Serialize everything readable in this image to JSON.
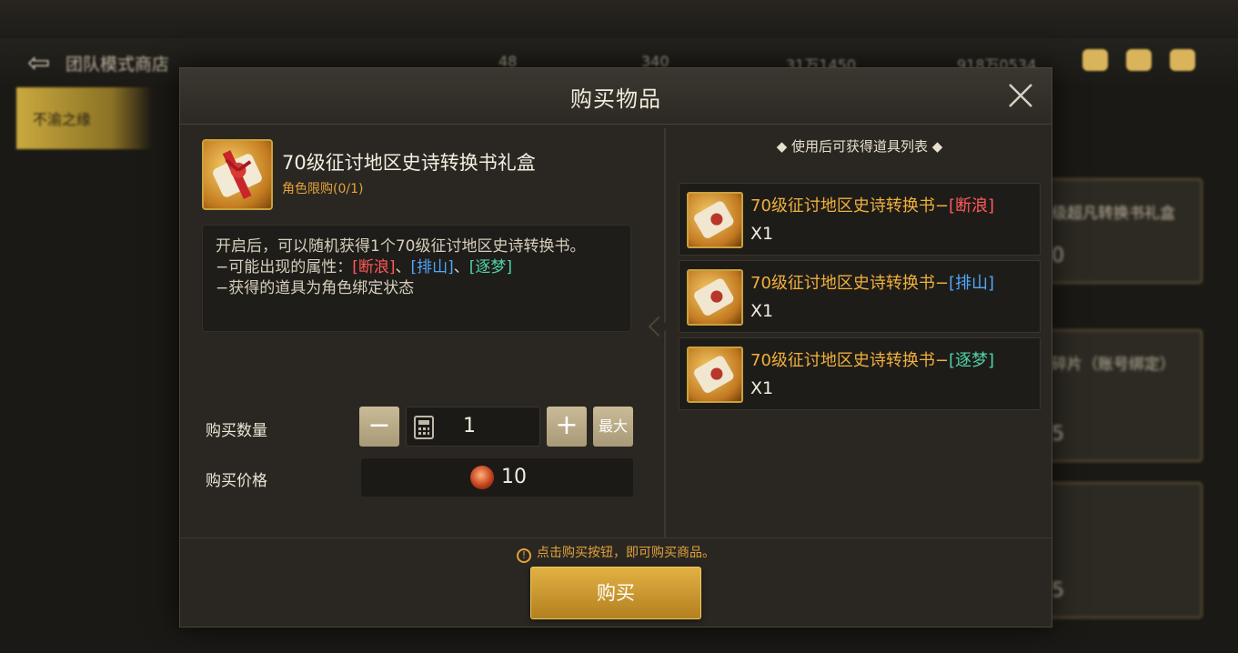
{
  "background": {
    "header_title": "团队模式商店",
    "tab_label": "不渝之缘",
    "currencies": [
      "48",
      "340",
      "31万1450",
      "918万0534"
    ],
    "cards": [
      {
        "title": "级超凡转换书礼盒",
        "value": "0"
      },
      {
        "title": "碎片（账号绑定）",
        "value": "5"
      },
      {
        "title": "",
        "value": "5"
      }
    ]
  },
  "modal": {
    "title": "购买物品",
    "item": {
      "name": "70级征讨地区史诗转换书礼盒",
      "limit": "角色限购(0/1)",
      "icon": "scroll-gift-box-icon"
    },
    "description": {
      "line1": "开启后，可以随机获得1个70级征讨地区史诗转换书。",
      "line2_prefix": "−可能出现的属性：",
      "attr1": "[断浪]",
      "sep1": "、",
      "attr2": "[排山]",
      "sep2": "、",
      "attr3": "[逐梦]",
      "line3": "−获得的道具为角色绑定状态"
    },
    "quantity": {
      "label": "购买数量",
      "minus": "−",
      "value": "1",
      "plus": "+",
      "max": "最大"
    },
    "price": {
      "label": "购买价格",
      "value": "10"
    },
    "rewards": {
      "title": "◆ 使用后可获得道具列表 ◆",
      "items": [
        {
          "name_prefix": "70级征讨地区史诗转换书−",
          "attr": "[断浪]",
          "qty": "X1"
        },
        {
          "name_prefix": "70级征讨地区史诗转换书−",
          "attr": "[排山]",
          "qty": "X1"
        },
        {
          "name_prefix": "70级征讨地区史诗转换书−",
          "attr": "[逐梦]",
          "qty": "X1"
        }
      ]
    },
    "notice": "点击购买按钮，即可购买商品。",
    "buy": "购买"
  },
  "colors": {
    "accent_gold": "#e3a23c",
    "attr_red": "#ff5a5a",
    "attr_blue": "#4fa6ff",
    "attr_green": "#4fd3a8"
  }
}
